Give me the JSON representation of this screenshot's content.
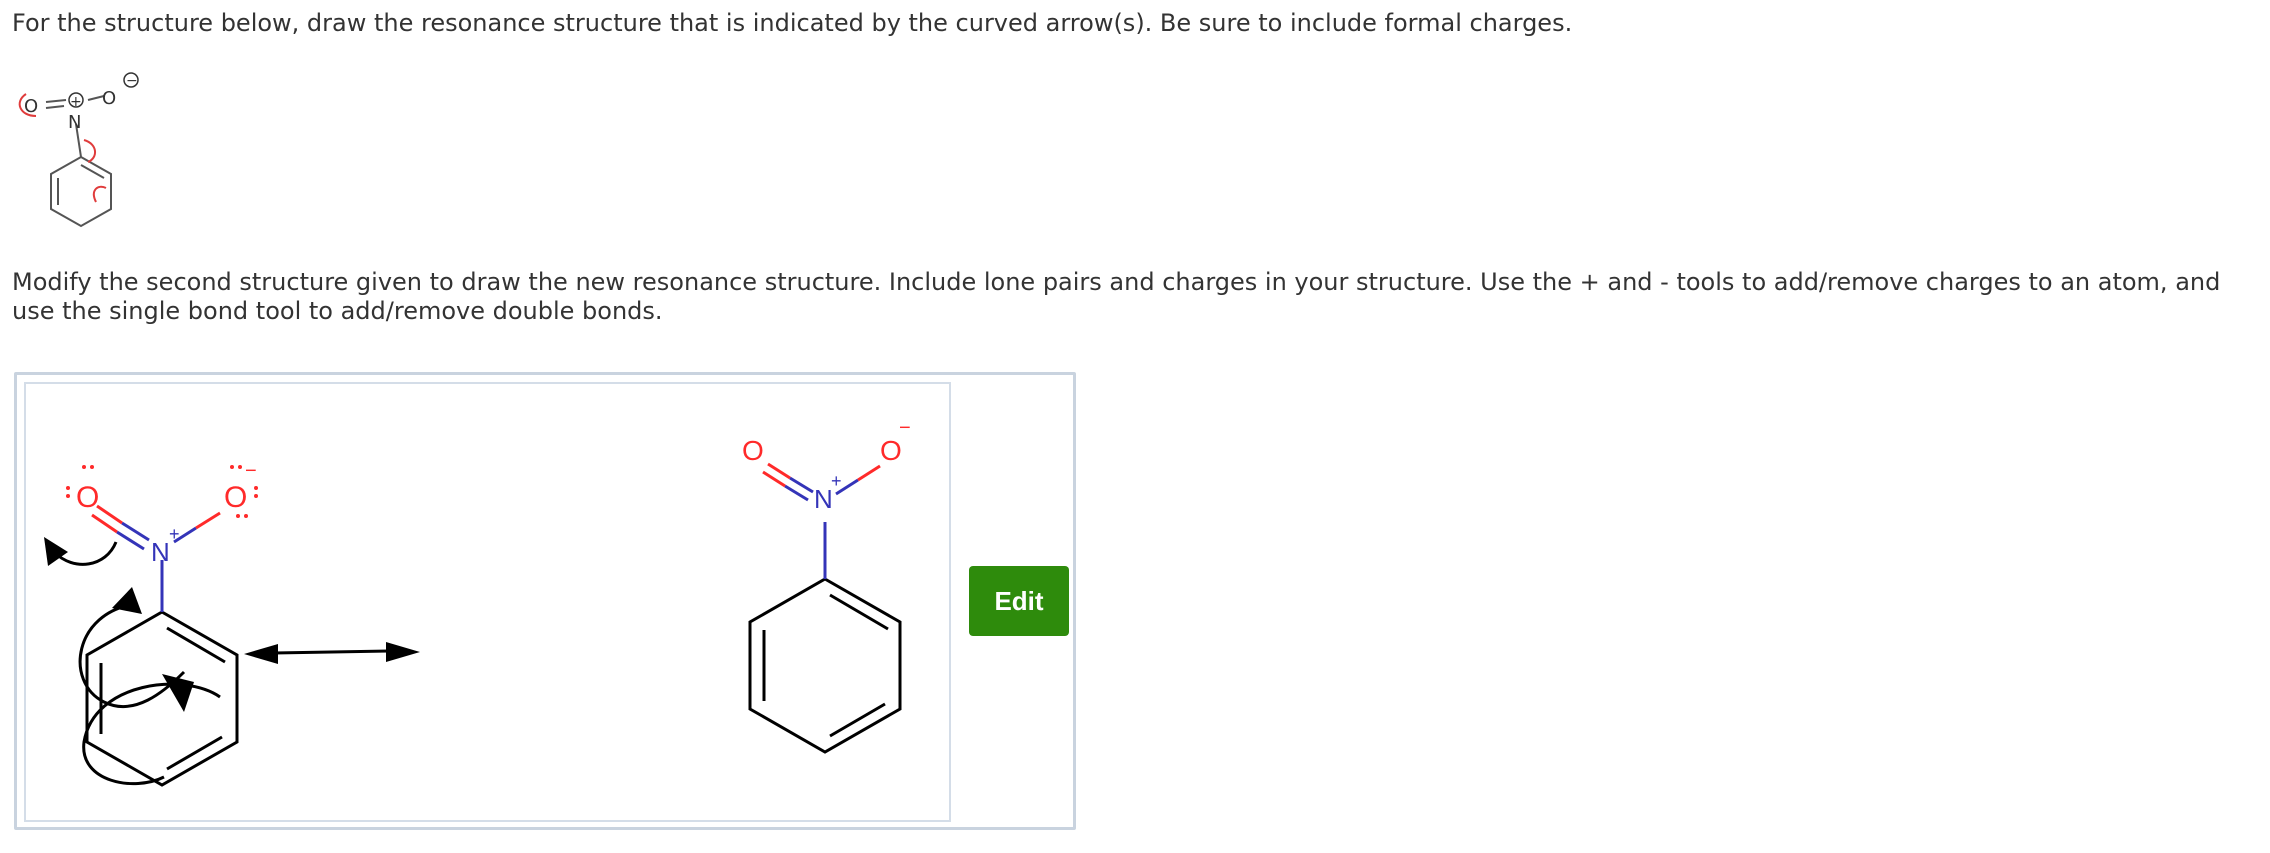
{
  "question": {
    "prompt": "For the structure below, draw the resonance structure that is indicated by the curved arrow(s). Be sure to include formal charges.",
    "instructions": "Modify the second structure given to draw the new resonance structure. Include lone pairs and charges in your structure. Use the + and - tools to add/remove charges to an atom, and use the single bond tool to add/remove double bonds."
  },
  "sketcher": {
    "edit_label": "Edit",
    "edit_color": "#2e8b0c",
    "oxygen_color": "#ff2a2a",
    "nitrogen_color": "#3434b8",
    "arrow_color": "#e03c3c"
  },
  "atoms": {
    "oxygen": "O",
    "nitrogen": "N",
    "plus": "+",
    "minus": "−"
  }
}
